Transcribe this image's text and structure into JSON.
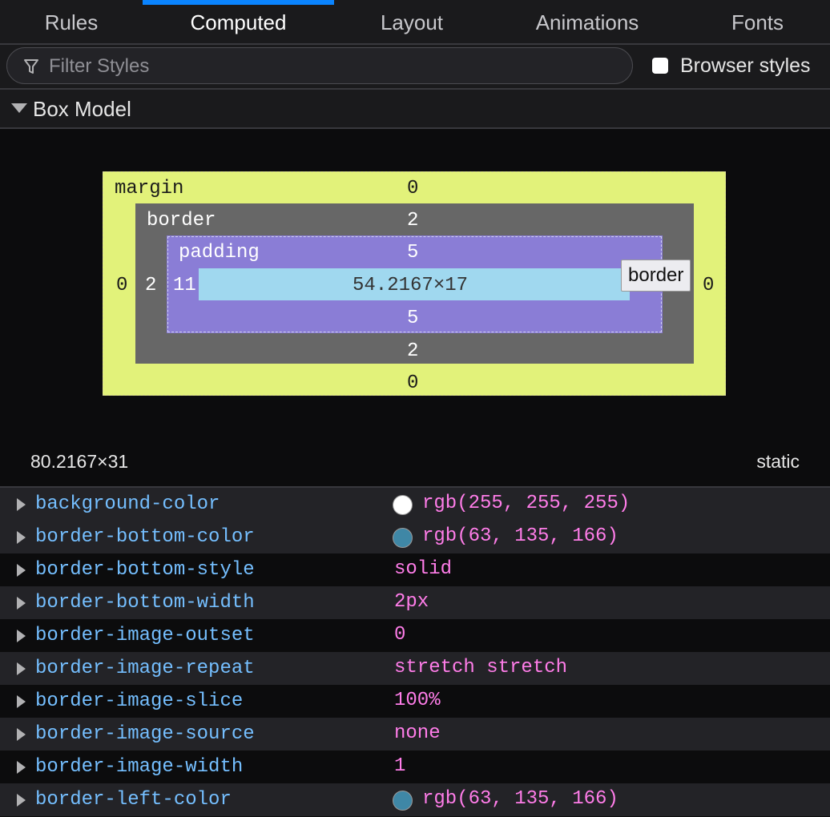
{
  "tabs": [
    {
      "label": "Rules"
    },
    {
      "label": "Computed"
    },
    {
      "label": "Layout"
    },
    {
      "label": "Animations"
    },
    {
      "label": "Fonts"
    }
  ],
  "active_tab": "Computed",
  "filter": {
    "placeholder": "Filter Styles",
    "value": ""
  },
  "browser_styles": {
    "label": "Browser styles",
    "checked": false
  },
  "box_model": {
    "section_title": "Box Model",
    "margin": {
      "label": "margin",
      "top": "0",
      "right": "0",
      "bottom": "0",
      "left": "0"
    },
    "border": {
      "label": "border",
      "top": "2",
      "right": "2",
      "bottom": "2",
      "left": "2"
    },
    "padding": {
      "label": "padding",
      "top": "5",
      "right": "11",
      "bottom": "5",
      "left": "11"
    },
    "content": "54.2167×17",
    "tooltip": "border",
    "size": "80.2167×31",
    "position": "static",
    "colors": {
      "margin": "#eeff80",
      "border": "#676767",
      "padding": "#8a7dd6",
      "content": "#a0d8ef"
    }
  },
  "properties": [
    {
      "name": "background-color",
      "value": "rgb(255, 255, 255)",
      "swatch": "#ffffff"
    },
    {
      "name": "border-bottom-color",
      "value": "rgb(63, 135, 166)",
      "swatch": "#3f87a6"
    },
    {
      "name": "border-bottom-style",
      "value": "solid"
    },
    {
      "name": "border-bottom-width",
      "value": "2px"
    },
    {
      "name": "border-image-outset",
      "value": "0"
    },
    {
      "name": "border-image-repeat",
      "value": "stretch stretch"
    },
    {
      "name": "border-image-slice",
      "value": "100%"
    },
    {
      "name": "border-image-source",
      "value": "none"
    },
    {
      "name": "border-image-width",
      "value": "1"
    },
    {
      "name": "border-left-color",
      "value": "rgb(63, 135, 166)",
      "swatch": "#3f87a6"
    }
  ]
}
